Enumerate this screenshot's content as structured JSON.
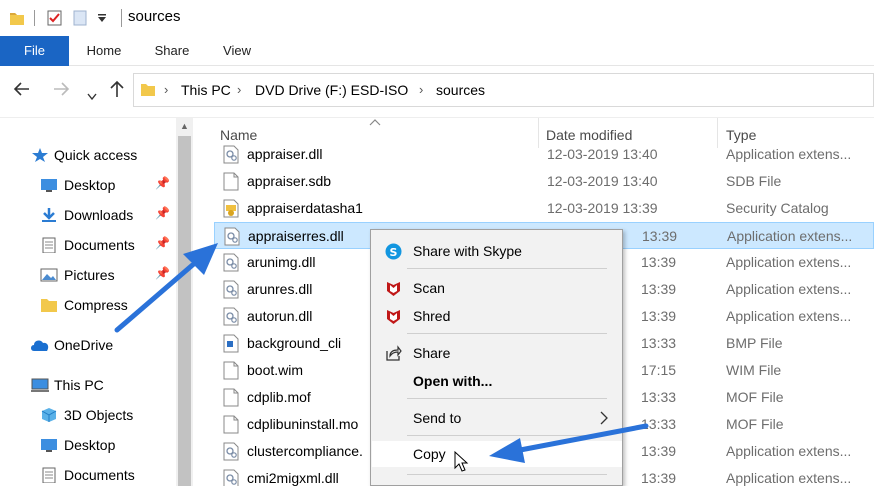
{
  "titlebar": {
    "title": "sources"
  },
  "ribbon": {
    "tabs": [
      "File",
      "Home",
      "Share",
      "View"
    ]
  },
  "address": {
    "crumbs": [
      "This PC",
      "DVD Drive (F:) ESD-ISO",
      "sources"
    ]
  },
  "nav": {
    "items": [
      {
        "label": "Quick access",
        "icon": "star-icon",
        "pinned": false
      },
      {
        "label": "Desktop",
        "icon": "desktop-icon",
        "pinned": true
      },
      {
        "label": "Downloads",
        "icon": "download-icon",
        "pinned": true
      },
      {
        "label": "Documents",
        "icon": "document-icon",
        "pinned": true
      },
      {
        "label": "Pictures",
        "icon": "picture-icon",
        "pinned": true
      },
      {
        "label": "Compress",
        "icon": "folder-icon",
        "pinned": false
      },
      {
        "label": "OneDrive",
        "icon": "cloud-icon",
        "pinned": false
      },
      {
        "label": "This PC",
        "icon": "computer-icon",
        "pinned": false
      },
      {
        "label": "3D Objects",
        "icon": "cube-icon",
        "pinned": false
      },
      {
        "label": "Desktop",
        "icon": "desktop-icon",
        "pinned": false
      },
      {
        "label": "Documents",
        "icon": "document-icon",
        "pinned": false
      }
    ]
  },
  "filelist": {
    "columns": [
      "Name",
      "Date modified",
      "Type"
    ],
    "rows": [
      {
        "name": "appraiser.dll",
        "date": "12-03-2019 13:40",
        "type": "Application extens...",
        "icon": "dll-icon"
      },
      {
        "name": "appraiser.sdb",
        "date": "12-03-2019 13:40",
        "type": "SDB File",
        "icon": "file-icon"
      },
      {
        "name": "appraiserdatasha1",
        "date": "12-03-2019 13:39",
        "type": "Security Catalog",
        "icon": "catalog-icon"
      },
      {
        "name": "appraiserres.dll",
        "date": "13:39",
        "type": "Application extens...",
        "icon": "dll-icon",
        "selected": true
      },
      {
        "name": "arunimg.dll",
        "date": "13:39",
        "type": "Application extens...",
        "icon": "dll-icon"
      },
      {
        "name": "arunres.dll",
        "date": "13:39",
        "type": "Application extens...",
        "icon": "dll-icon"
      },
      {
        "name": "autorun.dll",
        "date": "13:39",
        "type": "Application extens...",
        "icon": "dll-icon"
      },
      {
        "name": "background_cli",
        "date": "13:33",
        "type": "BMP File",
        "icon": "bmp-icon"
      },
      {
        "name": "boot.wim",
        "date": "17:15",
        "type": "WIM File",
        "icon": "file-icon"
      },
      {
        "name": "cdplib.mof",
        "date": "13:33",
        "type": "MOF File",
        "icon": "file-icon"
      },
      {
        "name": "cdplibuninstall.mo",
        "date": "13:33",
        "type": "MOF File",
        "icon": "file-icon"
      },
      {
        "name": "clustercompliance.",
        "date": "13:39",
        "type": "Application extens...",
        "icon": "dll-icon"
      },
      {
        "name": "cmi2migxml.dll",
        "date": "13:39",
        "type": "Application extens...",
        "icon": "dll-icon"
      }
    ]
  },
  "contextmenu": {
    "items": [
      {
        "label": "Share with Skype",
        "icon": "skype-icon"
      },
      {
        "label": "Scan",
        "icon": "mcafee-icon"
      },
      {
        "label": "Shred",
        "icon": "mcafee-icon"
      },
      {
        "label": "Share",
        "icon": "share-icon"
      },
      {
        "label": "Open with...",
        "icon": ""
      },
      {
        "label": "Send to",
        "icon": ""
      },
      {
        "label": "Copy",
        "icon": ""
      }
    ]
  },
  "colors": {
    "file_tab": "#1a65c4",
    "selection": "#cce8ff",
    "annotation_arrow": "#2a72d9",
    "mcafee": "#c01818"
  }
}
